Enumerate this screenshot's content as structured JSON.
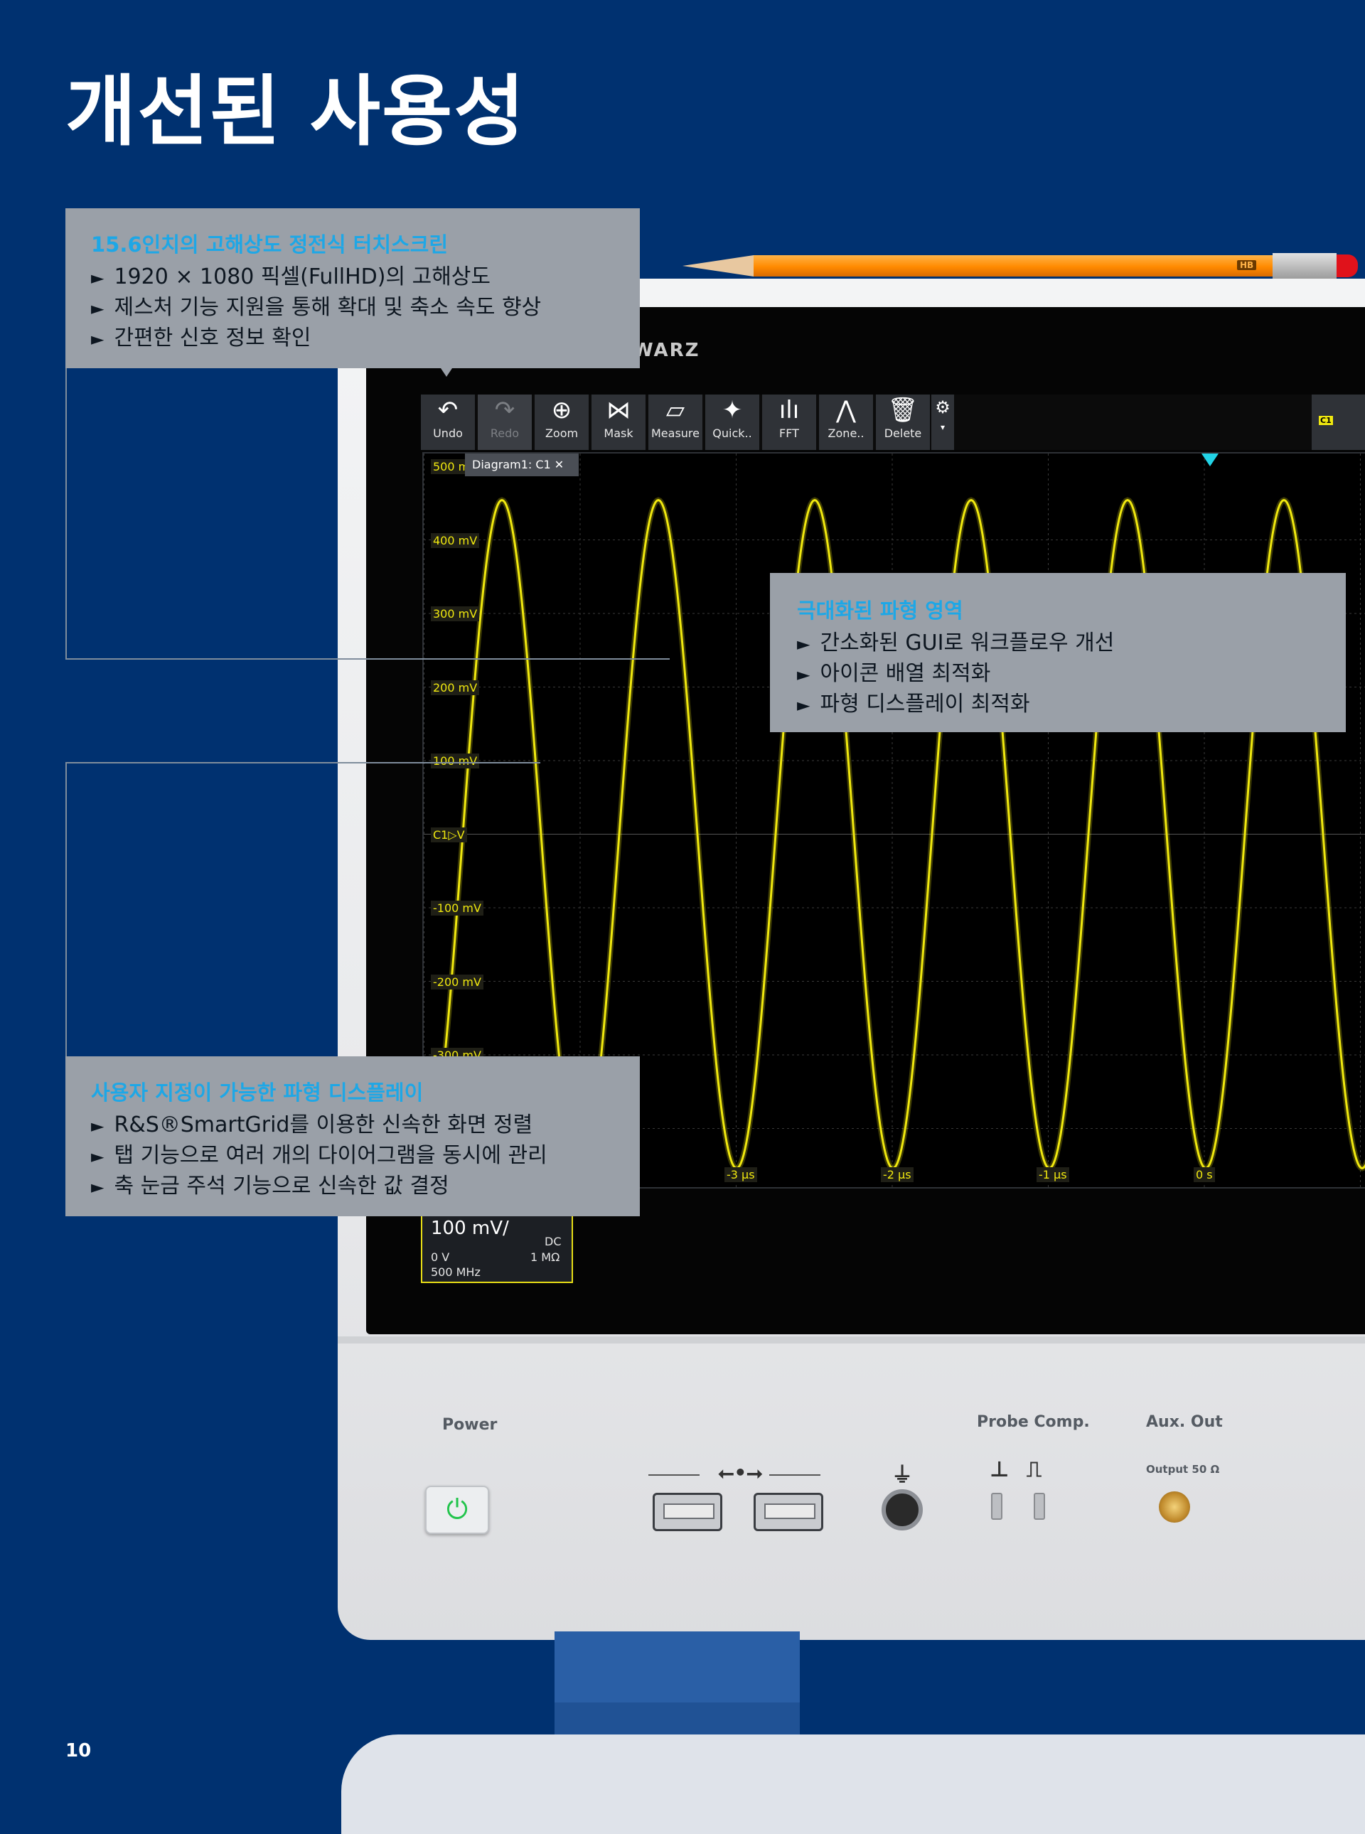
{
  "page": {
    "title": "개선된 사용성",
    "page_number": "10"
  },
  "callouts": [
    {
      "heading": "15.6인치의 고해상도 정전식 터치스크린",
      "items": [
        "1920 × 1080 픽셀(FullHD)의 고해상도",
        "제스처 기능 지원을 통해 확대 및 축소 속도 향상",
        "간편한 신호 정보 확인"
      ]
    },
    {
      "heading": "극대화된 파형 영역",
      "items": [
        "간소화된 GUI로 워크플로우 개선",
        "아이콘 배열 최적화",
        "파형 디스플레이 최적화"
      ]
    },
    {
      "heading": "사용자 지정이 가능한 파형 디스플레이",
      "items": [
        "R&S®SmartGrid를 이용한 신속한 화면 정렬",
        "탭 기능으로 여러 개의 다이어그램을 동시에 관리",
        "축 눈금 주석 기능으로 신속한 값 결정"
      ]
    }
  ],
  "bullet_glyph": "►",
  "scope": {
    "brand": "WARZ",
    "toolbar": [
      {
        "label": "Undo",
        "icon": "undo-icon",
        "glyph": "↶",
        "enabled": true
      },
      {
        "label": "Redo",
        "icon": "redo-icon",
        "glyph": "↷",
        "enabled": false
      },
      {
        "label": "Zoom",
        "icon": "zoom-icon",
        "glyph": "⊕",
        "enabled": true
      },
      {
        "label": "Mask",
        "icon": "mask-icon",
        "glyph": "⋈",
        "enabled": true
      },
      {
        "label": "Measure",
        "icon": "ruler-icon",
        "glyph": "▱",
        "enabled": true
      },
      {
        "label": "Quick..",
        "icon": "quick-measure-icon",
        "glyph": "✦",
        "enabled": true
      },
      {
        "label": "FFT",
        "icon": "fft-icon",
        "glyph": "ılı",
        "enabled": true
      },
      {
        "label": "Zone..",
        "icon": "zone-icon",
        "glyph": "⋀",
        "enabled": true
      },
      {
        "label": "Delete",
        "icon": "trash-icon",
        "glyph": "🗑",
        "enabled": true
      }
    ],
    "settings_glyph": "⚙",
    "channel_chip": "C1",
    "diagram_tab": "Diagram1: C1 ✕",
    "y_labels": [
      "500 mV",
      "400 mV",
      "300 mV",
      "200 mV",
      "100 mV",
      "C1▷V",
      "-100 mV",
      "-200 mV",
      "-300 mV"
    ],
    "x_labels": [
      "-3 µs",
      "-2 µs",
      "-1 µs",
      "0 s",
      "1"
    ],
    "channel_box": {
      "scale": "100 mV/",
      "coupling": "DC",
      "offset": "0 V",
      "impedance": "1 MΩ",
      "bandwidth": "500 MHz"
    },
    "front_panel": {
      "power": "Power",
      "probe_comp": "Probe Comp.",
      "aux_out": "Aux. Out",
      "output": "Output 50 Ω",
      "usb_symbol": "⭠•⭢",
      "ground_symbol": "⏚",
      "probe_symbols": [
        "⊥",
        "⎍"
      ],
      "power_glyph": "⏻"
    },
    "pencil_label": "HB"
  },
  "waveform": {
    "color": "#f0e80f",
    "frequency_MHz": 0.74,
    "amplitude_mV": 450
  }
}
